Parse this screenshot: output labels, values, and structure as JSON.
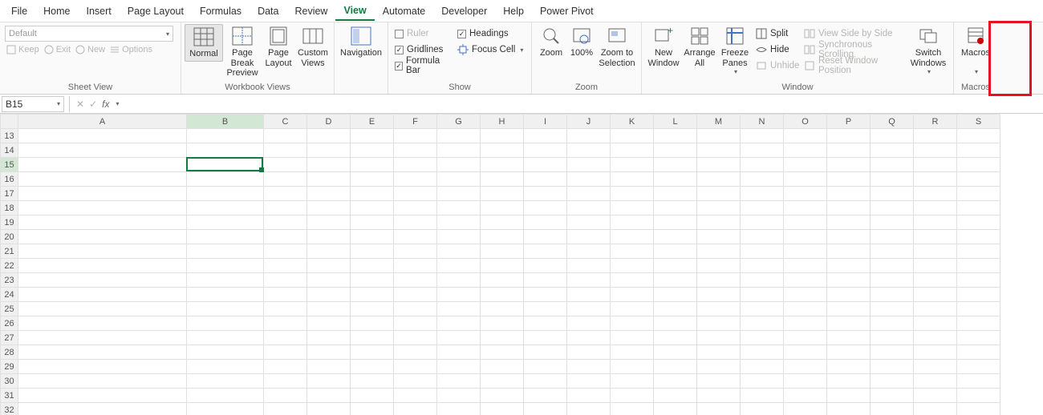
{
  "menu": {
    "tabs": [
      "File",
      "Home",
      "Insert",
      "Page Layout",
      "Formulas",
      "Data",
      "Review",
      "View",
      "Automate",
      "Developer",
      "Help",
      "Power Pivot"
    ],
    "active": "View"
  },
  "ribbon": {
    "sheetview": {
      "label": "Sheet View",
      "selector": "Default",
      "keep": "Keep",
      "exit": "Exit",
      "new": "New",
      "options": "Options"
    },
    "workbook_views": {
      "label": "Workbook Views",
      "normal": "Normal",
      "pagebreak": "Page Break Preview",
      "pagelayout": "Page Layout",
      "custom": "Custom Views"
    },
    "navigation": {
      "label": "Navigation"
    },
    "show": {
      "label": "Show",
      "ruler": "Ruler",
      "gridlines": "Gridlines",
      "formulabar": "Formula Bar",
      "headings": "Headings",
      "focuscell": "Focus Cell"
    },
    "zoom": {
      "label": "Zoom",
      "zoom": "Zoom",
      "p100": "100%",
      "zoomsel": "Zoom to Selection"
    },
    "window": {
      "label": "Window",
      "neww": "New Window",
      "arrange": "Arrange All",
      "freeze": "Freeze Panes",
      "split": "Split",
      "hide": "Hide",
      "unhide": "Unhide",
      "sidebyside": "View Side by Side",
      "syncscroll": "Synchronous Scrolling",
      "resetpos": "Reset Window Position",
      "switch": "Switch Windows"
    },
    "macros": {
      "label": "Macros",
      "btn": "Macros"
    }
  },
  "formula_bar": {
    "namebox": "B15",
    "fx": "fx"
  },
  "grid": {
    "columns": [
      "A",
      "B",
      "C",
      "D",
      "E",
      "F",
      "G",
      "H",
      "I",
      "J",
      "K",
      "L",
      "M",
      "N",
      "O",
      "P",
      "Q",
      "R",
      "S"
    ],
    "rows": [
      13,
      14,
      15,
      16,
      17,
      18,
      19,
      20,
      21,
      22,
      23,
      24,
      25,
      26,
      27,
      28,
      29,
      30,
      31,
      32
    ],
    "selected": {
      "col": "B",
      "row": 15
    }
  }
}
